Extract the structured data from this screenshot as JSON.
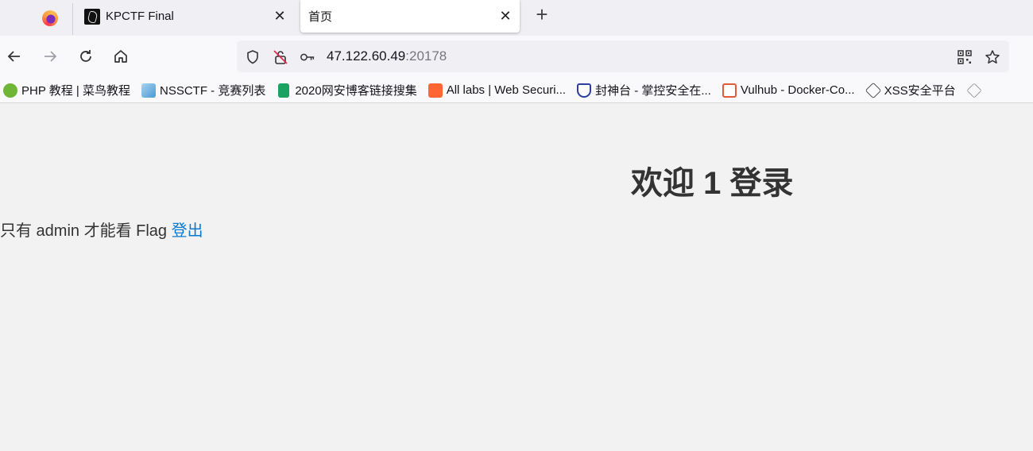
{
  "tabs": [
    {
      "title": "KPCTF Final",
      "icon": "kpctf-favicon-icon"
    },
    {
      "title": "首页",
      "icon": "none"
    }
  ],
  "address": {
    "host": "47.122.60.49",
    "port": ":20178"
  },
  "bookmarks": [
    {
      "label": "PHP 教程 | 菜鸟教程",
      "icon": "runoob-icon",
      "color": "#6fb536"
    },
    {
      "label": "NSSCTF - 竞赛列表",
      "icon": "nssctf-icon",
      "color": "#4a9ad4"
    },
    {
      "label": "2020网安博客链接搜集",
      "icon": "sheets-icon",
      "color": "#1aa260"
    },
    {
      "label": "All labs | Web Securi...",
      "icon": "portswigger-icon",
      "color": "#ff6633"
    },
    {
      "label": "封神台 - 掌控安全在...",
      "icon": "fengshentai-icon",
      "color": "#2b3f9e"
    },
    {
      "label": "Vulhub - Docker-Co...",
      "icon": "vulhub-icon",
      "color": "#e25a3a"
    },
    {
      "label": "XSS安全平台",
      "icon": "xss-cube-icon",
      "color": "#333333"
    }
  ],
  "page": {
    "welcome": "欢迎 1 登录",
    "message": "只有 admin 才能看 Flag",
    "logout": "登出"
  }
}
